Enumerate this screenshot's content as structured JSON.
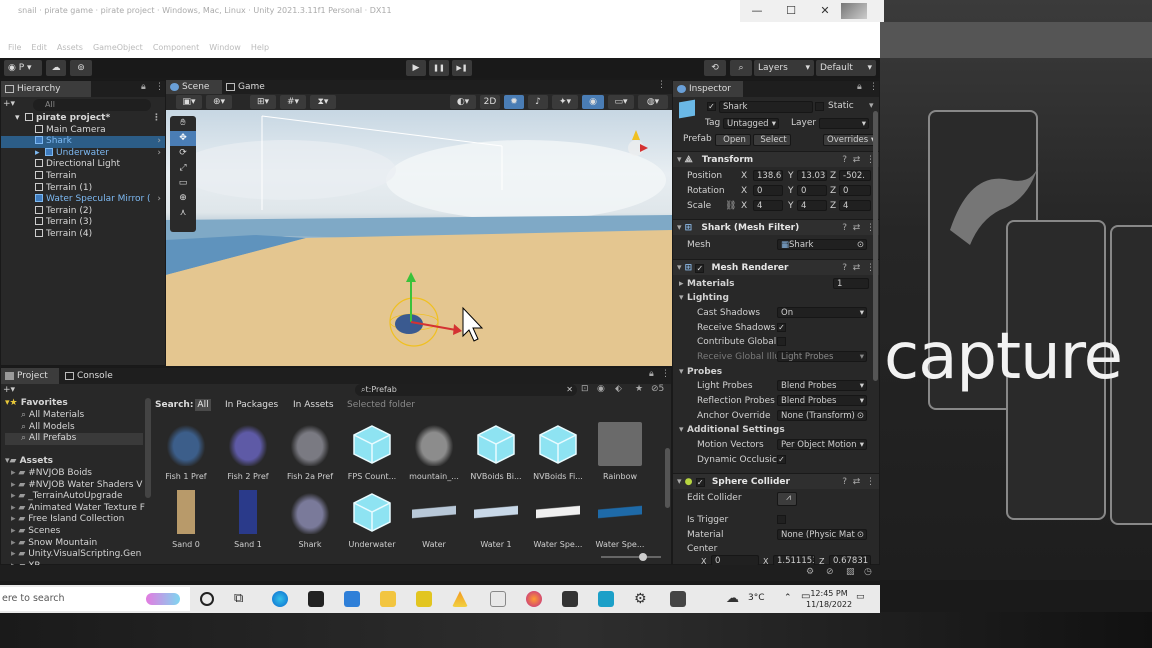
{
  "window": {
    "title": "snail · pirate game · pirate project · Windows, Mac, Linux · Unity 2021.3.11f1 Personal · DX11",
    "minimize": "—",
    "maximize": "☐",
    "close": "✕"
  },
  "menu": [
    "File",
    "Edit",
    "Assets",
    "GameObject",
    "Component",
    "Window",
    "Help"
  ],
  "toolbar": {
    "account": "P",
    "play": "▶",
    "pause": "❚❚",
    "step": "▶❚",
    "layers": "Layers",
    "layout": "Default"
  },
  "hierarchy": {
    "tab": "Hierarchy",
    "search_placeholder": "All",
    "items": [
      {
        "label": "pirate project*",
        "indent": 0
      },
      {
        "label": "Main Camera",
        "indent": 1
      },
      {
        "label": "Shark",
        "indent": 1
      },
      {
        "label": "Underwater",
        "indent": 1
      },
      {
        "label": "Directional Light",
        "indent": 1
      },
      {
        "label": "Terrain",
        "indent": 1
      },
      {
        "label": "Terrain (1)",
        "indent": 1
      },
      {
        "label": "Water Specular Mirror (",
        "indent": 1
      },
      {
        "label": "Terrain (2)",
        "indent": 1
      },
      {
        "label": "Terrain (3)",
        "indent": 1
      },
      {
        "label": "Terrain (4)",
        "indent": 1
      }
    ]
  },
  "scene": {
    "tab_scene": "Scene",
    "tab_game": "Game",
    "mode_2d": "2D"
  },
  "project": {
    "tab_project": "Project",
    "tab_console": "Console",
    "search_value": "t:Prefab",
    "search_label": "Search:",
    "filter_all": "All",
    "filter_packages": "In Packages",
    "filter_assets": "In Assets",
    "filter_selected": "Selected folder",
    "hidden_count": "5",
    "favorites_label": "Favorites",
    "favorites": [
      "All Materials",
      "All Models",
      "All Prefabs"
    ],
    "assets_label": "Assets",
    "folders": [
      "#NVJOB Boids",
      "#NVJOB Water Shaders V",
      "_TerrainAutoUpgrade",
      "Animated Water Texture F",
      "Free Island Collection",
      "Scenes",
      "Snow Mountain",
      "Unity.VisualScripting.Gen",
      "XR"
    ],
    "items_row1": [
      "Fish 1 Pref",
      "Fish 2 Pref",
      "Fish 2a Pref",
      "FPS Count...",
      "mountain_...",
      "NVBoids Bi...",
      "NVBoids Fi...",
      "Rainbow"
    ],
    "items_row2": [
      "Sand 0",
      "Sand 1",
      "Shark",
      "Underwater",
      "Water",
      "Water 1",
      "Water Spe...",
      "Water Spe..."
    ]
  },
  "inspector": {
    "tab": "Inspector",
    "object_name": "Shark",
    "static_label": "Static",
    "tag_label": "Tag",
    "tag_value": "Untagged",
    "layer_label": "Layer",
    "prefab_label": "Prefab",
    "open_button": "Open",
    "select_button": "Select",
    "overrides_button": "Overrides",
    "transform": {
      "title": "Transform",
      "position_label": "Position",
      "rotation_label": "Rotation",
      "scale_label": "Scale",
      "pos": [
        "138.6",
        "13.03",
        "-502."
      ],
      "rot": [
        "0",
        "0",
        "0"
      ],
      "scale": [
        "4",
        "4",
        "4"
      ],
      "x": "X",
      "y": "Y",
      "z": "Z"
    },
    "mesh_filter": {
      "title": "Shark (Mesh Filter)",
      "mesh_label": "Mesh",
      "mesh_value": "Shark"
    },
    "mesh_renderer": {
      "title": "Mesh Renderer",
      "materials_label": "Materials",
      "materials_count": "1",
      "lighting_label": "Lighting",
      "cast_shadows_label": "Cast Shadows",
      "cast_shadows_value": "On",
      "receive_shadows_label": "Receive Shadows",
      "contribute_gi_label": "Contribute Global",
      "receive_gi_label": "Receive Global Illu",
      "receive_gi_value": "Light Probes",
      "probes_label": "Probes",
      "light_probes_label": "Light Probes",
      "light_probes_value": "Blend Probes",
      "reflection_probes_label": "Reflection Probes",
      "reflection_probes_value": "Blend Probes",
      "anchor_override_label": "Anchor Override",
      "anchor_override_value": "None (Transform)",
      "additional_label": "Additional Settings",
      "motion_vectors_label": "Motion Vectors",
      "motion_vectors_value": "Per Object Motion",
      "dynamic_occlusion_label": "Dynamic Occlusic"
    },
    "sphere_collider": {
      "title": "Sphere Collider",
      "edit_collider_label": "Edit Collider",
      "is_trigger_label": "Is Trigger",
      "material_label": "Material",
      "material_value": "None (Physic Mat",
      "center_label": "Center",
      "center_x": "0",
      "center_y": "1.511153",
      "center_z": "0.67831"
    }
  },
  "taskbar": {
    "search_placeholder": "ere to search",
    "weather": "3°C",
    "time": "12:45 PM",
    "date": "11/18/2022"
  },
  "background": {
    "capture_text": "capture"
  },
  "colors": {
    "selection": "#2c5d87",
    "prefab_blue": "#7db9f2",
    "panel": "#282828",
    "header": "#1e1e1e"
  }
}
